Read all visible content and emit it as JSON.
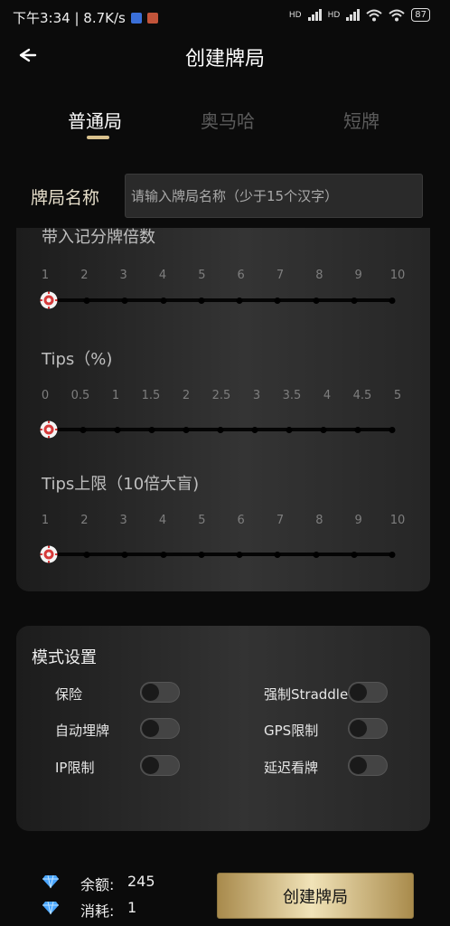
{
  "status_bar": {
    "time_speed": "下午3:34 | 8.7K/s",
    "network_labels": [
      "HD",
      "HD"
    ],
    "battery": "87"
  },
  "header": {
    "title": "创建牌局"
  },
  "tabs": [
    {
      "label": "普通局",
      "active": true
    },
    {
      "label": "奥马哈",
      "active": false
    },
    {
      "label": "短牌",
      "active": false
    }
  ],
  "name_field": {
    "label": "牌局名称",
    "placeholder": "请输入牌局名称（少于15个汉字）",
    "value": ""
  },
  "sliders": [
    {
      "title": "带入记分牌倍数",
      "ticks": [
        "1",
        "2",
        "3",
        "4",
        "5",
        "6",
        "7",
        "8",
        "9",
        "10"
      ],
      "value": "1"
    },
    {
      "title": "Tips（%)",
      "ticks": [
        "0",
        "0.5",
        "1",
        "1.5",
        "2",
        "2.5",
        "3",
        "3.5",
        "4",
        "4.5",
        "5"
      ],
      "value": "0"
    },
    {
      "title": "Tips上限（10倍大盲)",
      "ticks": [
        "1",
        "2",
        "3",
        "4",
        "5",
        "6",
        "7",
        "8",
        "9",
        "10"
      ],
      "value": "1"
    }
  ],
  "mode_settings": {
    "title": "模式设置",
    "options": [
      {
        "label": "保险",
        "on": false
      },
      {
        "label": "强制Straddle",
        "on": false
      },
      {
        "label": "自动埋牌",
        "on": false
      },
      {
        "label": "GPS限制",
        "on": false
      },
      {
        "label": "IP限制",
        "on": false
      },
      {
        "label": "延迟看牌",
        "on": false
      }
    ]
  },
  "footer": {
    "balance_label": "余额:",
    "balance_value": "245",
    "cost_label": "消耗:",
    "cost_value": "1",
    "create_button": "创建牌局"
  },
  "icons": {
    "back": "arrow-left-icon",
    "gem": "diamond-icon",
    "slider_thumb": "poker-chip-icon"
  },
  "colors": {
    "accent_gold": "#d9c18d",
    "button_gold": "#f1e3b8"
  }
}
